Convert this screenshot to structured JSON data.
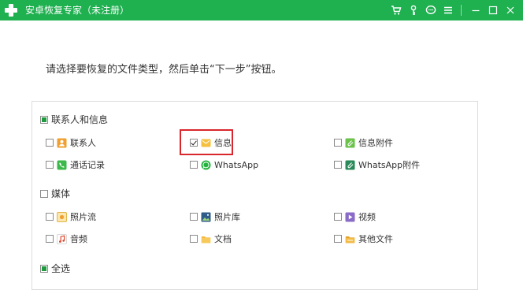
{
  "titlebar": {
    "title": "安卓恢复专家（未注册）",
    "bg_color": "#1fb050",
    "icons": [
      "cart-icon",
      "key-icon",
      "chat-icon",
      "menu-icon",
      "minimize-icon",
      "maximize-icon",
      "close-icon"
    ]
  },
  "instruction": "请选择要恢复的文件类型，然后单击“下一步”按钮。",
  "groups": {
    "contacts_messages": {
      "label": "联系人和信息",
      "state": "partial",
      "items": {
        "contacts": {
          "label": "联系人",
          "checked": false,
          "icon": "contacts-icon"
        },
        "messages": {
          "label": "信息",
          "checked": true,
          "icon": "messages-icon"
        },
        "message_attachments": {
          "label": "信息附件",
          "checked": false,
          "icon": "attachment-icon"
        },
        "call_logs": {
          "label": "通话记录",
          "checked": false,
          "icon": "phone-icon"
        },
        "whatsapp": {
          "label": "WhatsApp",
          "checked": false,
          "icon": "whatsapp-icon"
        },
        "whatsapp_attachments": {
          "label": "WhatsApp附件",
          "checked": false,
          "icon": "whatsapp-attachment-icon"
        }
      }
    },
    "media": {
      "label": "媒体",
      "state": "unchecked",
      "items": {
        "photo_stream": {
          "label": "照片流",
          "checked": false,
          "icon": "photo-stream-icon"
        },
        "photo_library": {
          "label": "照片库",
          "checked": false,
          "icon": "photo-library-icon"
        },
        "video": {
          "label": "视频",
          "checked": false,
          "icon": "video-icon"
        },
        "audio": {
          "label": "音频",
          "checked": false,
          "icon": "audio-icon"
        },
        "documents": {
          "label": "文档",
          "checked": false,
          "icon": "folder-icon"
        },
        "other_files": {
          "label": "其他文件",
          "checked": false,
          "icon": "other-files-icon"
        }
      }
    },
    "select_all": {
      "label": "全选",
      "state": "partial"
    }
  },
  "highlight_color": "#d9262c"
}
